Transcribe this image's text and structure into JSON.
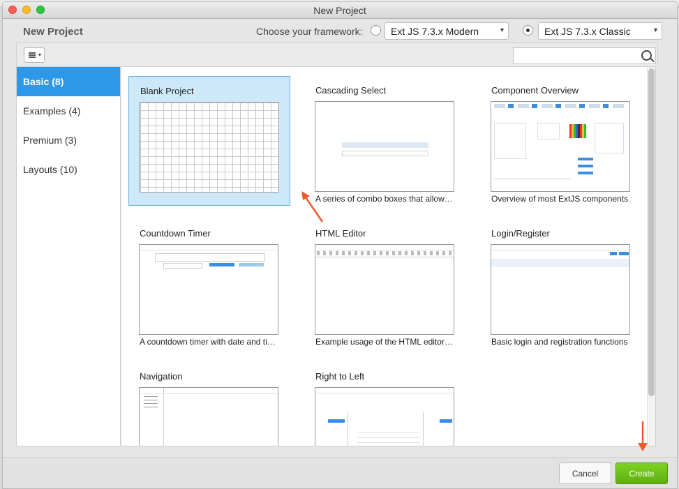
{
  "window": {
    "title": "New Project"
  },
  "header": {
    "title": "New Project",
    "framework_label": "Choose your framework:",
    "frameworks": [
      {
        "label": "Ext JS 7.3.x Modern",
        "selected": false
      },
      {
        "label": "Ext JS 7.3.x Classic",
        "selected": true
      }
    ]
  },
  "toolbar": {
    "view_icon": "list-view-icon",
    "search_placeholder": "",
    "search_icon": "search-icon"
  },
  "sidebar": {
    "items": [
      {
        "label": "Basic (8)",
        "active": true
      },
      {
        "label": "Examples (4)",
        "active": false
      },
      {
        "label": "Premium (3)",
        "active": false
      },
      {
        "label": "Layouts (10)",
        "active": false
      }
    ]
  },
  "templates": [
    {
      "title": "Blank Project",
      "description": "",
      "selected": true
    },
    {
      "title": "Cascading Select",
      "description": "A series of combo boxes that allow…",
      "selected": false
    },
    {
      "title": "Component Overview",
      "description": "Overview of most ExtJS components",
      "selected": false
    },
    {
      "title": "Countdown Timer",
      "description": "A countdown timer with date and ti…",
      "selected": false
    },
    {
      "title": "HTML Editor",
      "description": "Example usage of the HTML editor…",
      "selected": false
    },
    {
      "title": "Login/Register",
      "description": "Basic login and registration functions",
      "selected": false
    },
    {
      "title": "Navigation",
      "description": "",
      "selected": false
    },
    {
      "title": "Right to Left",
      "description": "",
      "selected": false
    }
  ],
  "footer": {
    "cancel_label": "Cancel",
    "create_label": "Create"
  },
  "colors": {
    "accent": "#2d97e8",
    "create": "#6cc11a",
    "annotation_arrow": "#f05a28"
  }
}
